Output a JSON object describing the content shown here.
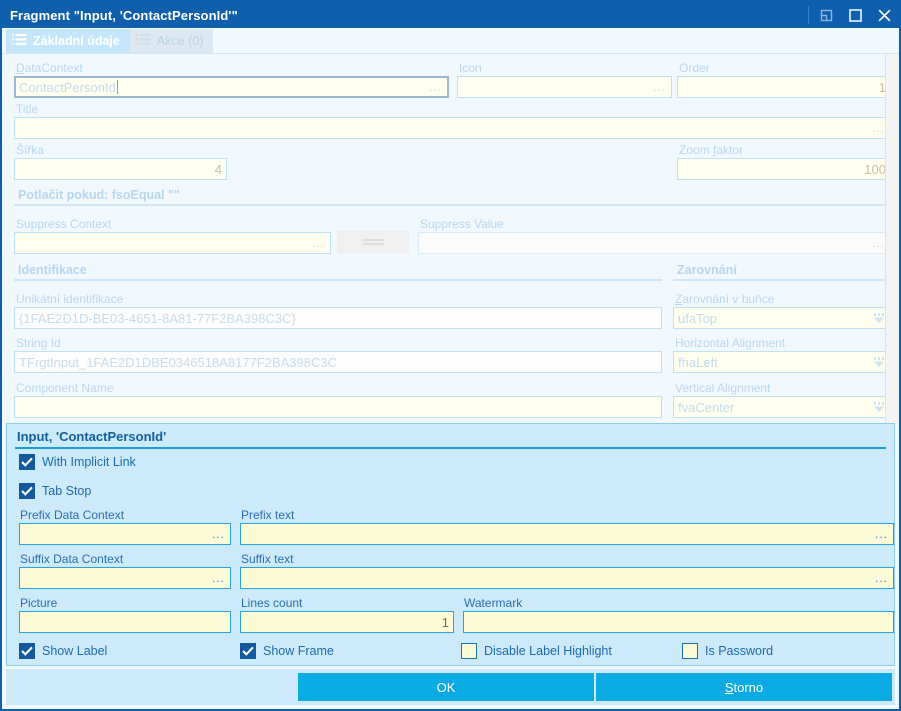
{
  "window": {
    "title": "Fragment \"Input, 'ContactPersonId'\"",
    "buttons": {
      "restore": "restore-down",
      "maximize": "maximize",
      "close": "close"
    }
  },
  "tabs": [
    {
      "label": "Základní údaje",
      "active": true
    },
    {
      "label": "Akce (0)",
      "active": false
    }
  ],
  "main": {
    "data_context": {
      "label": "DataContext",
      "accel": "D",
      "value": "ContactPersonId",
      "ellipsis": "..."
    },
    "icon": {
      "label": "Icon",
      "value": "",
      "ellipsis": "..."
    },
    "order": {
      "label": "Order",
      "value": "1"
    },
    "title": {
      "label": "Title",
      "value": "",
      "ellipsis": "..."
    },
    "sirka": {
      "label": "Šířka",
      "value": "4"
    },
    "zoom_faktor": {
      "label_before": "Zoom ",
      "accel": "f",
      "label_after": "aktor",
      "value": "100"
    },
    "suppress_section": {
      "heading": "Potlačit pokud:  fsoEqual \"\"",
      "context": {
        "label": "Suppress Context",
        "value": "",
        "ellipsis": "..."
      },
      "button": "suppress-operator-button",
      "value_field": {
        "label": "Suppress Value",
        "value": "",
        "ellipsis": "..."
      }
    },
    "identifikace": {
      "heading": "Identifikace",
      "unique_id": {
        "label": "Unikátní identifikace",
        "value": "{1FAE2D1D-BE03-4651-8A81-77F2BA398C3C}"
      },
      "string_id": {
        "label": "String Id",
        "value": "TFrgtInput_1FAE2D1DBE0346518A8177F2BA398C3C"
      },
      "component_name": {
        "label": "Component Name",
        "value": ""
      }
    },
    "zarovnani": {
      "heading": "Zarovnání",
      "cell_alignment": {
        "label_before": "",
        "accel": "Z",
        "label_after": "arovnání v buňce",
        "value": "ufaTop"
      },
      "horizontal_alignment": {
        "label": "Horizontal Alignment",
        "value": "fhaLeft"
      },
      "vertical_alignment": {
        "label": "Vertical Alignment",
        "value": "fvaCenter"
      }
    }
  },
  "detail": {
    "heading": "Input, 'ContactPersonId'",
    "with_implicit_link": {
      "label": "With Implicit Link",
      "checked": true
    },
    "tab_stop": {
      "label": "Tab Stop",
      "checked": true
    },
    "prefix_data_context": {
      "label": "Prefix Data Context",
      "value": "",
      "ellipsis": "..."
    },
    "prefix_text": {
      "label": "Prefix text",
      "value": "",
      "ellipsis": "..."
    },
    "suffix_data_context": {
      "label": "Suffix Data Context",
      "value": "",
      "ellipsis": "..."
    },
    "suffix_text": {
      "label": "Suffix text",
      "value": "",
      "ellipsis": "..."
    },
    "picture": {
      "label": "Picture",
      "value": ""
    },
    "lines_count": {
      "label": "Lines count",
      "value": "1"
    },
    "watermark": {
      "label": "Watermark",
      "value": ""
    },
    "show_label": {
      "label": "Show Label",
      "checked": true
    },
    "show_frame": {
      "label": "Show Frame",
      "checked": true
    },
    "disable_label_highlight": {
      "label": "Disable Label Highlight",
      "checked": false
    },
    "is_password": {
      "label": "Is Password",
      "checked": false
    }
  },
  "footer": {
    "ok": "OK",
    "cancel_accel": "S",
    "cancel_rest": "torno"
  },
  "colors": {
    "title_bar": "#0f5fad",
    "accent_button": "#0aaae4",
    "panel_bg": "#cdeafb",
    "form_bg": "#f2f9fe",
    "field_bg": "#fffff0",
    "detail_field_bg": "#fcfbd7"
  }
}
